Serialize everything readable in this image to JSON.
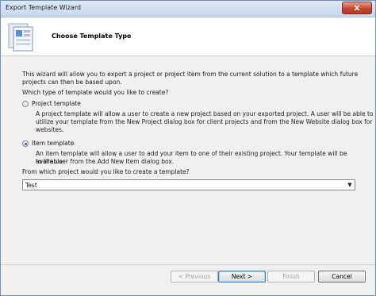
{
  "window": {
    "title": "Export Template Wizard",
    "close_glyph": "x"
  },
  "header": {
    "title": "Choose Template Type"
  },
  "intro": {
    "line1": "This wizard will allow you to export a project or project item from the current solution to a template which future",
    "line2": "projects can then be based upon.",
    "question": "Which type of template would you like to create?"
  },
  "options": [
    {
      "label": "Project template",
      "selected": false,
      "desc": [
        "A project template will allow a user to create a new project based on your exported project. A user will be able to",
        "utilize your template from the New Project dialog box for client projects and from the New Website dialog box for",
        "websites."
      ]
    },
    {
      "label": "Item template",
      "selected": true,
      "desc": [
        "An item template will allow a user to add your item to one of their existing project. Your template will be available",
        "to the user from the Add New Item dialog box."
      ]
    }
  ],
  "project_select": {
    "label": "From which project would you like to create a template?",
    "value": "Test"
  },
  "buttons": {
    "previous": "< Previous",
    "next": "Next >",
    "finish": "Finish",
    "cancel": "Cancel"
  }
}
